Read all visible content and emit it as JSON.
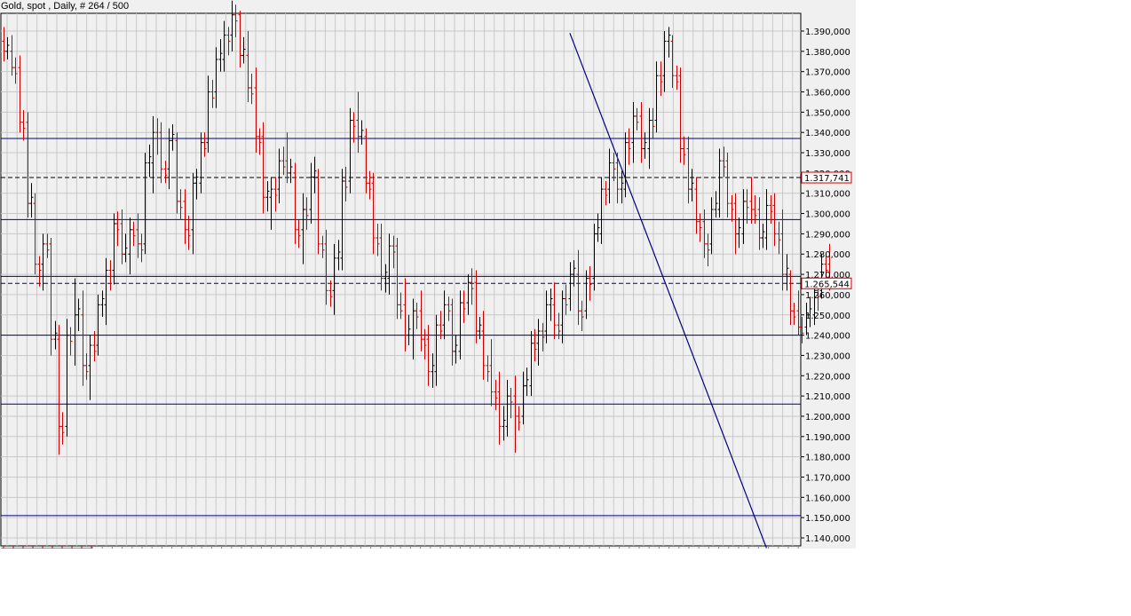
{
  "chart_data": {
    "type": "ohlc",
    "title": "Gold, spot , Daily, # 264 / 500",
    "ylim": [
      1135,
      1400
    ],
    "y_ticks": [
      1140,
      1150,
      1160,
      1170,
      1180,
      1190,
      1200,
      1210,
      1220,
      1230,
      1240,
      1250,
      1260,
      1270,
      1280,
      1290,
      1300,
      1310,
      1320,
      1330,
      1340,
      1350,
      1360,
      1370,
      1380,
      1390
    ],
    "y_tick_labels": [
      "1.140,000",
      "1.150,000",
      "1.160,000",
      "1.170,000",
      "1.180,000",
      "1.190,000",
      "1.200,000",
      "1.210,000",
      "1.220,000",
      "1.230,000",
      "1.240,000",
      "1.250,000",
      "1.260,000",
      "1.270,000",
      "1.280,000",
      "1.290,000",
      "1.300,000",
      "1.310,000",
      "1.320,000",
      "1.330,000",
      "1.340,000",
      "1.350,000",
      "1.360,000",
      "1.370,000",
      "1.380,000",
      "1.390,000"
    ],
    "grid": true,
    "horizontal_lines": [
      1337,
      1297,
      1269,
      1240,
      1206,
      1151
    ],
    "price_markers": [
      {
        "value": 1317.741,
        "label": "1.317,741",
        "style": "dashed"
      },
      {
        "value": 1265.544,
        "label": "1.265,544",
        "style": "dashed"
      }
    ],
    "trendline": {
      "from_bar": 144,
      "from_value": 1389,
      "to_bar": 194,
      "to_value": 1135
    },
    "colors": {
      "up": "#000000",
      "down": "#cc0000",
      "lines": "#000080",
      "marker_box": "#cc0000",
      "grid": "#c8c8c8",
      "background": "#f0f0f0"
    },
    "bars": [
      [
        1385,
        1392,
        1375,
        1380
      ],
      [
        1380,
        1388,
        1368,
        1372
      ],
      [
        1372,
        1378,
        1340,
        1345
      ],
      [
        1345,
        1350,
        1298,
        1305
      ],
      [
        1305,
        1310,
        1270,
        1275
      ],
      [
        1275,
        1290,
        1262,
        1285
      ],
      [
        1285,
        1288,
        1230,
        1238
      ],
      [
        1238,
        1245,
        1181,
        1195
      ],
      [
        1195,
        1248,
        1190,
        1240
      ],
      [
        1240,
        1268,
        1225,
        1250
      ],
      [
        1250,
        1262,
        1215,
        1225
      ],
      [
        1225,
        1240,
        1208,
        1235
      ],
      [
        1235,
        1260,
        1230,
        1255
      ],
      [
        1255,
        1278,
        1245,
        1272
      ],
      [
        1272,
        1300,
        1265,
        1295
      ],
      [
        1295,
        1302,
        1275,
        1280
      ],
      [
        1280,
        1298,
        1270,
        1292
      ],
      [
        1292,
        1300,
        1278,
        1285
      ],
      [
        1285,
        1330,
        1280,
        1325
      ],
      [
        1325,
        1348,
        1310,
        1340
      ],
      [
        1340,
        1345,
        1315,
        1322
      ],
      [
        1322,
        1342,
        1312,
        1336
      ],
      [
        1336,
        1340,
        1300,
        1306
      ],
      [
        1306,
        1312,
        1285,
        1292
      ],
      [
        1292,
        1320,
        1280,
        1315
      ],
      [
        1315,
        1340,
        1310,
        1335
      ],
      [
        1335,
        1368,
        1330,
        1360
      ],
      [
        1360,
        1382,
        1352,
        1376
      ],
      [
        1376,
        1395,
        1370,
        1388
      ],
      [
        1388,
        1405,
        1380,
        1398
      ],
      [
        1398,
        1400,
        1372,
        1378
      ],
      [
        1378,
        1390,
        1355,
        1362
      ],
      [
        1362,
        1372,
        1330,
        1338
      ],
      [
        1338,
        1345,
        1300,
        1308
      ],
      [
        1308,
        1318,
        1292,
        1312
      ],
      [
        1312,
        1332,
        1305,
        1326
      ],
      [
        1326,
        1340,
        1315,
        1320
      ],
      [
        1320,
        1325,
        1285,
        1292
      ],
      [
        1292,
        1310,
        1275,
        1302
      ],
      [
        1302,
        1325,
        1295,
        1318
      ],
      [
        1318,
        1322,
        1280,
        1285
      ],
      [
        1285,
        1292,
        1255,
        1262
      ],
      [
        1262,
        1285,
        1250,
        1278
      ],
      [
        1278,
        1322,
        1272,
        1316
      ],
      [
        1316,
        1352,
        1310,
        1346
      ],
      [
        1346,
        1360,
        1330,
        1338
      ],
      [
        1338,
        1342,
        1310,
        1315
      ],
      [
        1315,
        1320,
        1280,
        1288
      ],
      [
        1288,
        1295,
        1262,
        1268
      ],
      [
        1268,
        1290,
        1260,
        1284
      ],
      [
        1284,
        1288,
        1248,
        1255
      ],
      [
        1255,
        1268,
        1232,
        1240
      ],
      [
        1240,
        1258,
        1228,
        1252
      ],
      [
        1252,
        1262,
        1232,
        1238
      ],
      [
        1238,
        1245,
        1215,
        1222
      ],
      [
        1222,
        1250,
        1215,
        1245
      ],
      [
        1245,
        1262,
        1238,
        1255
      ],
      [
        1255,
        1258,
        1225,
        1232
      ],
      [
        1232,
        1262,
        1228,
        1256
      ],
      [
        1256,
        1270,
        1250,
        1266
      ],
      [
        1266,
        1272,
        1236,
        1242
      ],
      [
        1242,
        1252,
        1218,
        1225
      ],
      [
        1225,
        1238,
        1205,
        1212
      ],
      [
        1212,
        1222,
        1186,
        1195
      ],
      [
        1195,
        1218,
        1190,
        1210
      ],
      [
        1210,
        1220,
        1182,
        1200
      ],
      [
        1200,
        1222,
        1196,
        1215
      ],
      [
        1215,
        1242,
        1210,
        1236
      ],
      [
        1236,
        1248,
        1225,
        1242
      ],
      [
        1242,
        1262,
        1236,
        1255
      ],
      [
        1255,
        1266,
        1238,
        1245
      ],
      [
        1245,
        1262,
        1236,
        1258
      ],
      [
        1258,
        1276,
        1252,
        1270
      ],
      [
        1270,
        1282,
        1245,
        1252
      ],
      [
        1252,
        1272,
        1248,
        1268
      ],
      [
        1268,
        1295,
        1262,
        1290
      ],
      [
        1290,
        1318,
        1285,
        1312
      ],
      [
        1312,
        1332,
        1305,
        1325
      ],
      [
        1325,
        1330,
        1305,
        1312
      ],
      [
        1312,
        1340,
        1308,
        1335
      ],
      [
        1335,
        1355,
        1325,
        1348
      ],
      [
        1348,
        1355,
        1325,
        1332
      ],
      [
        1332,
        1352,
        1322,
        1346
      ],
      [
        1346,
        1375,
        1340,
        1368
      ],
      [
        1368,
        1390,
        1360,
        1385
      ],
      [
        1385,
        1388,
        1362,
        1368
      ],
      [
        1368,
        1372,
        1325,
        1332
      ],
      [
        1332,
        1338,
        1305,
        1312
      ],
      [
        1312,
        1318,
        1290,
        1296
      ],
      [
        1296,
        1302,
        1278,
        1285
      ],
      [
        1285,
        1308,
        1280,
        1302
      ],
      [
        1302,
        1332,
        1298,
        1326
      ],
      [
        1326,
        1330,
        1298,
        1305
      ],
      [
        1305,
        1310,
        1280,
        1290
      ],
      [
        1290,
        1312,
        1285,
        1306
      ],
      [
        1306,
        1318,
        1295,
        1302
      ],
      [
        1302,
        1308,
        1282,
        1288
      ],
      [
        1288,
        1312,
        1282,
        1304
      ],
      [
        1304,
        1310,
        1284,
        1290
      ],
      [
        1290,
        1302,
        1262,
        1270
      ],
      [
        1270,
        1272,
        1245,
        1252
      ],
      [
        1252,
        1262,
        1240,
        1244
      ],
      [
        1244,
        1256,
        1240,
        1250
      ],
      [
        1250,
        1265,
        1245,
        1262
      ],
      [
        1262,
        1280,
        1258,
        1275
      ],
      [
        1275,
        1285,
        1262,
        1266
      ]
    ]
  }
}
